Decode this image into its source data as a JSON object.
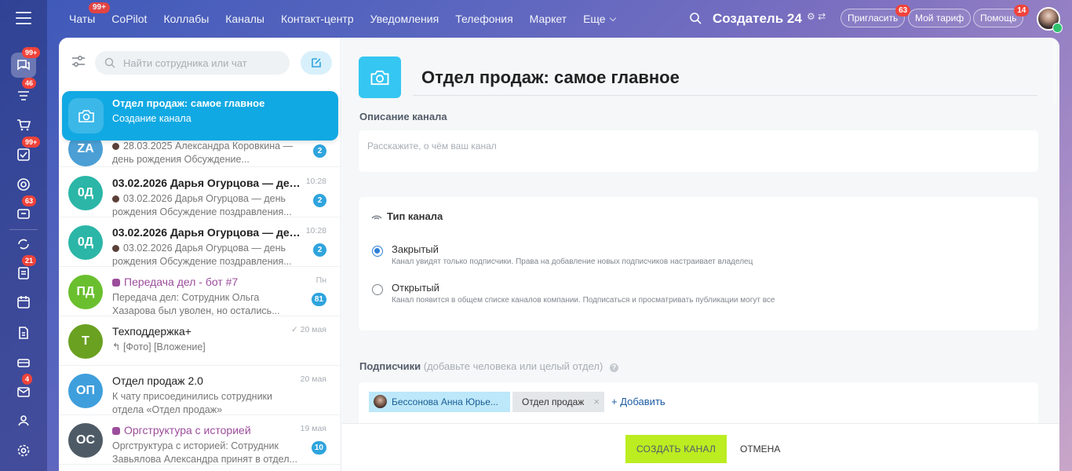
{
  "nav": {
    "chats": "Чаты",
    "chats_badge": "99+",
    "copilot": "CoPilot",
    "collabs": "Коллабы",
    "channels": "Каналы",
    "contact_center": "Контакт-центр",
    "notifications": "Уведомления",
    "telephony": "Телефония",
    "market": "Маркет",
    "more": "Еще"
  },
  "header": {
    "brand": "Создатель 24",
    "invite": "Пригласить",
    "invite_badge": "63",
    "tariff": "Мой тариф",
    "help": "Помощь",
    "help_badge": "14"
  },
  "left_bar_badges": {
    "chat": "99+",
    "feed": "46",
    "tasks": "99+",
    "crm": "63",
    "docs": "21",
    "mail": "4"
  },
  "search": {
    "placeholder": "Найти сотрудника или чат"
  },
  "active_chat": {
    "name": "Отдел продаж: самое главное",
    "sub": "Создание канала"
  },
  "chats": [
    {
      "initials": "ZA",
      "msg": "28.03.2025 Александра Коровкина — день рождения Обсуждение...",
      "count": "2"
    },
    {
      "initials": "0Д",
      "name": "03.02.2026 Дарья Огурцова — день...",
      "time": "10:28",
      "msg": "03.02.2026 Дарья Огурцова — день рождения Обсуждение поздравления...",
      "count": "2"
    },
    {
      "initials": "0Д",
      "name": "03.02.2026 Дарья Огурцова — день...",
      "time": "10:28",
      "msg": "03.02.2026 Дарья Огурцова — день рождения Обсуждение поздравления...",
      "count": "2"
    },
    {
      "initials": "ПД",
      "name": "Передача дел - бот #7",
      "time": "Пн",
      "msg": "Передача дел: Сотрудник Ольга Хазарова был уволен, но остались...",
      "count": "81"
    },
    {
      "initials": "Т",
      "name": "Техподдержка+",
      "time": "20 мая",
      "msg": "[Фото] [Вложение]"
    },
    {
      "initials": "ОП",
      "name": "Отдел продаж 2.0",
      "time": "20 мая",
      "msg": "К чату присоединились сотрудники отдела «Отдел продаж»"
    },
    {
      "initials": "ОС",
      "name": "Оргструктура с историей",
      "time": "19 мая",
      "msg": "Оргструктура с историей: Сотрудник Завьялова Александра принят в отдел...",
      "count": "10"
    }
  ],
  "form": {
    "title": "Отдел продаж: самое главное",
    "desc_label": "Описание канала",
    "desc_placeholder": "Расскажите, о чём ваш канал",
    "type_label": "Тип канала",
    "closed_title": "Закрытый",
    "closed_desc": "Канал увидят только подписчики. Права на добавление новых подписчиков настраивает владелец",
    "open_title": "Открытый",
    "open_desc": "Канал появится в общем списке каналов компании. Подписаться и просматривать публикации могут все",
    "subs_label": "Подписчики",
    "subs_hint": "(добавьте человека или целый отдел)",
    "subscriber_user": "Бессонова Анна Юрье...",
    "subscriber_dept": "Отдел продаж",
    "add_label": "Добавить",
    "create_btn": "СОЗДАТЬ КАНАЛ",
    "cancel_btn": "ОТМЕНА"
  },
  "colors": {
    "accent": "#11a9e3",
    "create_btn": "#bbed21",
    "badge": "#f0433a",
    "avatar_za": "#4b9fd5",
    "avatar_od": "#2bb6a7",
    "avatar_pd": "#6abf2e",
    "avatar_t": "#6aa121",
    "avatar_op": "#3f9fdc",
    "avatar_os": "#4e5b66"
  }
}
